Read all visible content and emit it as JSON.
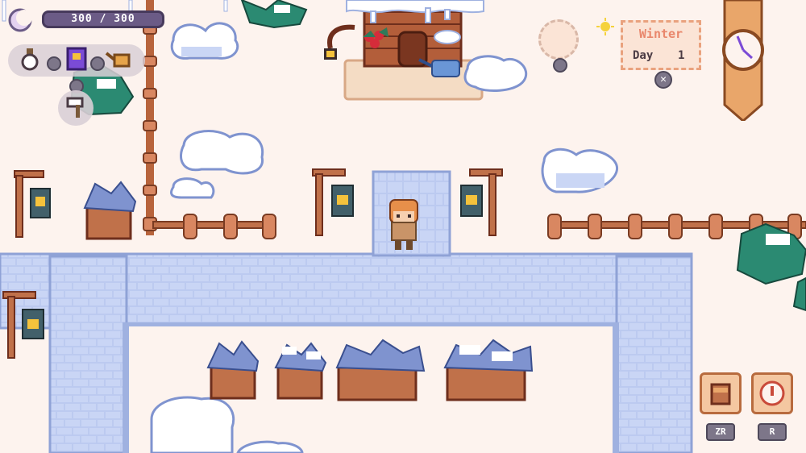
{
  "hud": {
    "energy": {
      "text": "300 / 300",
      "current": 300,
      "max": 300
    },
    "season": {
      "name": "Winter",
      "day_label": "Day",
      "day_number": "1"
    },
    "weather_icon": "sun-icon",
    "buttons": {
      "zr_label": "ZR",
      "r_label": "R"
    },
    "tools": [
      "potion-icon",
      "spellbook-icon",
      "watering-can-icon",
      "axe-icon"
    ]
  },
  "colors": {
    "snow_ground": "#fdf3ee",
    "stone": "#b9c8ee",
    "stone_dark": "#7f93cf",
    "wood": "#c0714a",
    "energy_bar": "#6b5b86",
    "season_text": "#e9876c"
  }
}
